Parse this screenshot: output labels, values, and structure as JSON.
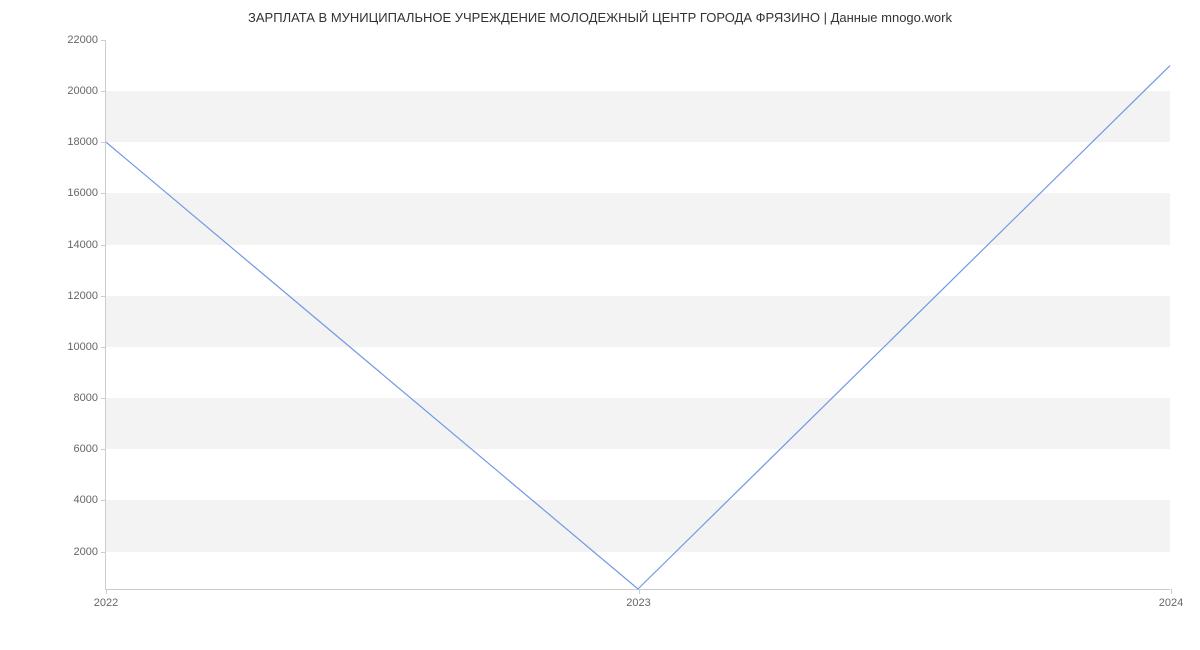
{
  "chart_data": {
    "type": "line",
    "title": "ЗАРПЛАТА В МУНИЦИПАЛЬНОЕ УЧРЕЖДЕНИЕ МОЛОДЕЖНЫЙ ЦЕНТР ГОРОДА ФРЯЗИНО | Данные mnogo.work",
    "xlabel": "",
    "ylabel": "",
    "x": [
      2022,
      2023,
      2024
    ],
    "x_ticks": [
      "2022",
      "2023",
      "2024"
    ],
    "y_ticks": [
      2000,
      4000,
      6000,
      8000,
      10000,
      12000,
      14000,
      16000,
      18000,
      20000,
      22000
    ],
    "ylim": [
      500,
      22000
    ],
    "xlim": [
      2022,
      2024
    ],
    "series": [
      {
        "name": "salary",
        "values": [
          18000,
          500,
          21000
        ]
      }
    ],
    "grid": {
      "horizontal_bands": true
    }
  }
}
